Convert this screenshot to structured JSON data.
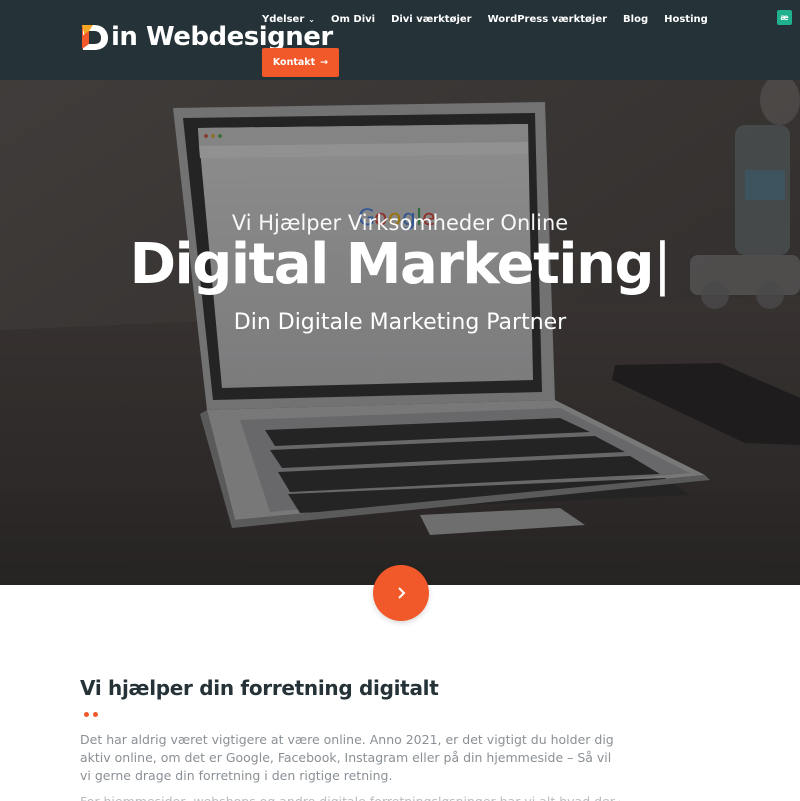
{
  "header": {
    "logo_text": "in Webdesigner",
    "logo_mark": "D",
    "nav": [
      {
        "label": "Ydelser",
        "has_dropdown": true
      },
      {
        "label": "Om Divi"
      },
      {
        "label": "Divi værktøjer"
      },
      {
        "label": "WordPress værktøjer"
      },
      {
        "label": "Blog"
      },
      {
        "label": "Hosting"
      }
    ],
    "cta_label": "Kontakt",
    "cta_icon": "arrow-right-icon",
    "corner_badge": "æ"
  },
  "hero": {
    "subtitle": "Vi Hjælper Virksomheder Online",
    "title": "Digital Marketing",
    "cursor": "|",
    "tagline": "Din Digitale Marketing Partner",
    "scroll_icon": "chevron-right-icon"
  },
  "content": {
    "heading": "Vi hjælper din forretning digitalt",
    "paragraph": "Det har aldrig været vigtigere at være online. Anno 2021, er det vigtigt du holder dig aktiv online, om det er Google, Facebook, Instagram eller på din hjemmeside – Så vil vi gerne drage din forretning i den rigtige retning.",
    "paragraph2": "For hjemmesider, webshops og andre digitale forretningsløsninger har vi alt hvad der skal til"
  },
  "colors": {
    "header_bg": "#253238",
    "accent": "#f1592a",
    "badge": "#20b08e"
  }
}
